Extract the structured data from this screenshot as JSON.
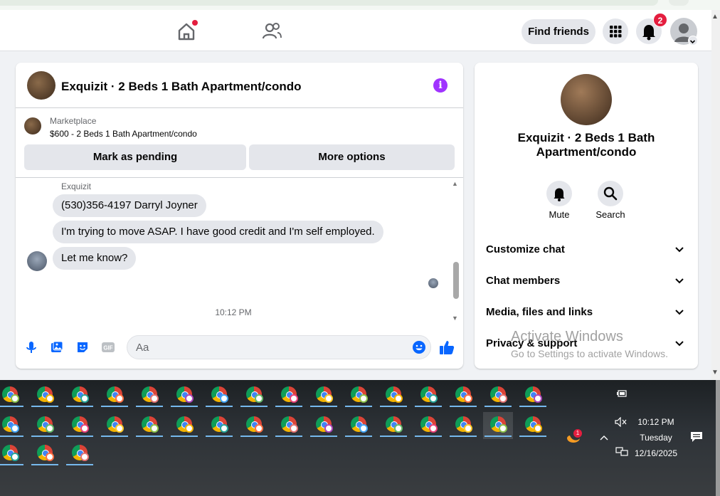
{
  "topnav": {
    "find_friends_label": "Find friends",
    "notification_count": "2"
  },
  "chat": {
    "title": "Exquizit · 2 Beds 1 Bath Apartment/condo",
    "marketplace_label": "Marketplace",
    "listing_price_title": "$600 - 2 Beds 1 Bath Apartment/condo",
    "mark_pending_label": "Mark as pending",
    "more_options_label": "More options",
    "sender_name": "Exquizit",
    "messages": [
      "(530)356-4197 Darryl Joyner",
      "I'm trying to move ASAP. I have good credit and I'm self employed.",
      "Let me know?"
    ],
    "timestamp": "10:12 PM",
    "composer_placeholder": "Aa"
  },
  "info_panel": {
    "title": "Exquizit · 2 Beds 1 Bath Apartment/condo",
    "mute_label": "Mute",
    "search_label": "Search",
    "sections": [
      "Customize chat",
      "Chat members",
      "Media, files and links",
      "Privacy & support"
    ]
  },
  "watermark": {
    "line1": "Activate Windows",
    "line2": "Go to Settings to activate Windows."
  },
  "taskbar": {
    "time": "10:12 PM",
    "day": "Tuesday",
    "date": "12/16/2025",
    "mascot_badge": "1",
    "profile_colors": [
      "#8bc34a",
      "#f4b400",
      "#26a69a",
      "#ff7043",
      "#e57373",
      "#ab47bc",
      "#42a5f5",
      "#66bb6a",
      "#ec407a",
      "#ffca28"
    ]
  },
  "colors": {
    "accent_purple": "#a033ff",
    "like_blue": "#0866ff",
    "badge_red": "#e41e3f"
  }
}
